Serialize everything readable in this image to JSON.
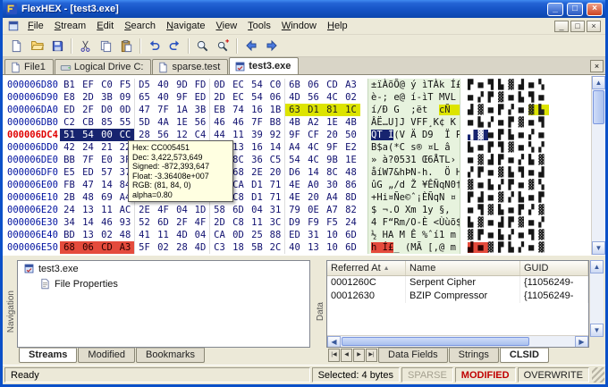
{
  "titlebar": {
    "title": "FlexHEX - [test3.exe]"
  },
  "menu": {
    "items": [
      "File",
      "Stream",
      "Edit",
      "Search",
      "Navigate",
      "View",
      "Tools",
      "Window",
      "Help"
    ]
  },
  "toolbar": {
    "groups": [
      [
        "new-file-icon",
        "open-folder-icon",
        "save-icon"
      ],
      [
        "cut-icon",
        "copy-icon",
        "paste-icon"
      ],
      [
        "undo-icon",
        "redo-icon"
      ],
      [
        "find-icon",
        "find-next-icon"
      ],
      [
        "back-icon",
        "forward-icon"
      ]
    ]
  },
  "doc_tabs": [
    {
      "label": "File1",
      "icon": "file-icon",
      "active": false
    },
    {
      "label": "Logical Drive C:",
      "icon": "drive-icon",
      "active": false
    },
    {
      "label": "sparse.test",
      "icon": "file-icon",
      "active": false
    },
    {
      "label": "test3.exe",
      "icon": "exe-icon",
      "active": true
    }
  ],
  "hex": {
    "rows": [
      {
        "addr": "000006D80",
        "bytes": [
          "B1",
          "EF",
          "C0",
          "F5",
          "D5",
          "40",
          "9D",
          "FD",
          "0D",
          "EC",
          "54",
          "C0",
          "6B",
          "06",
          "CD",
          "A3"
        ],
        "ansi": "±ïÀõÕ@ ý ìTÀk Í£",
        "uni": "▛■▜▙▓▟■▚"
      },
      {
        "addr": "000006D90",
        "bytes": [
          "E8",
          "2D",
          "3B",
          "09",
          "65",
          "40",
          "9F",
          "ED",
          "2D",
          "EC",
          "54",
          "06",
          "4D",
          "56",
          "4C",
          "02"
        ],
        "ansi": "è-; e@ í-ìT MVL ",
        "uni": "■▞▛▓■▙▜■"
      },
      {
        "addr": "000006DA0",
        "bytes": [
          "ED",
          "2F",
          "D0",
          "0D",
          "47",
          "7F",
          "1A",
          "3B",
          "EB",
          "74",
          "16",
          "1B",
          "63",
          "D1",
          "81",
          "1C"
        ],
        "ansi": "í/Ð G  ;ët  cÑ  ",
        "uni": "▟▓■▛▞■▓▙",
        "hl": [
          12,
          15
        ]
      },
      {
        "addr": "000006DB0",
        "bytes": [
          "C2",
          "CB",
          "85",
          "55",
          "5D",
          "4A",
          "1E",
          "56",
          "46",
          "46",
          "7F",
          "B8",
          "4B",
          "A2",
          "1E",
          "4B"
        ],
        "ansi": "ÂË…U]J VFF¸K¢ K ",
        "uni": "■▙▞■▛▓■▜"
      },
      {
        "addr": "000006DC4",
        "bytes": [
          "51",
          "54",
          "00",
          "CC",
          "28",
          "56",
          "12",
          "C4",
          "44",
          "11",
          "39",
          "92",
          "9F",
          "CF",
          "20",
          "50"
        ],
        "ansi": "QT Ì(V Ä D9  Ï P",
        "uni": "▜▓■▛▙■▞■",
        "sel": [
          0,
          3
        ],
        "addr_sel": true
      },
      {
        "addr": "000006DD0",
        "bytes": [
          "42",
          "24",
          "21",
          "22",
          "2A",
          "43",
          "03",
          "73",
          "8C",
          "13",
          "16",
          "14",
          "A4",
          "4C",
          "9F",
          "E2"
        ],
        "ansi": "B$a(*C s® ¤L â  ",
        "uni": "▙■▛▜▓■▚▞"
      },
      {
        "addr": "000006DE0",
        "bytes": [
          "BB",
          "7F",
          "E0",
          "3F",
          "30",
          "35",
          "33",
          "31",
          "1D",
          "8C",
          "36",
          "C5",
          "54",
          "4C",
          "9B",
          "1E"
        ],
        "ansi": "» à?0531 Œ6ÅTL› ",
        "uni": "■▓▟▛■▞▙▓"
      },
      {
        "addr": "000006DF0",
        "bytes": [
          "E5",
          "ED",
          "57",
          "37",
          "26",
          "68",
          "DE",
          "4E",
          "2D",
          "68",
          "2E",
          "20",
          "D6",
          "14",
          "8C",
          "48"
        ],
        "ansi": "åíW7&hÞN-h.  Ö H",
        "uni": "▞▛■▓▙▜■▟"
      },
      {
        "addr": "000006E00",
        "bytes": [
          "FB",
          "47",
          "14",
          "84",
          "5C",
          "64",
          "8E",
          "19",
          "A5",
          "CA",
          "D1",
          "71",
          "4E",
          "A0",
          "30",
          "86"
        ],
        "ansi": "ûG „/d Ž ¥ÊÑqN0†",
        "uni": "▓■▙▞▛■▓▚"
      },
      {
        "addr": "000006E10",
        "bytes": [
          "2B",
          "48",
          "69",
          "A4",
          "D1",
          "65",
          "A9",
          "88",
          "A1",
          "C8",
          "D1",
          "71",
          "4E",
          "20",
          "A4",
          "8D"
        ],
        "ansi": "+Hi¤Ñe©ˆ¡ÈÑqN ¤ ",
        "uni": "▛▟■▓▞▙■▛"
      },
      {
        "addr": "000006E20",
        "bytes": [
          "24",
          "13",
          "11",
          "AC",
          "2E",
          "4F",
          "04",
          "1D",
          "58",
          "6D",
          "04",
          "31",
          "79",
          "0E",
          "A7",
          "82"
        ],
        "ansi": "$ ¬.O Xm 1y §‚  ",
        "uni": "■▜▓▙■▛▞▓"
      },
      {
        "addr": "000006E30",
        "bytes": [
          "34",
          "14",
          "46",
          "93",
          "52",
          "6D",
          "2F",
          "4F",
          "2D",
          "C8",
          "11",
          "3C",
          "D9",
          "F9",
          "F5",
          "24"
        ],
        "ansi": "4 F“Rm/O-È <Ùùõ$",
        "uni": "▙▓■▟▛▓■▞"
      },
      {
        "addr": "000006E40",
        "bytes": [
          "BD",
          "13",
          "02",
          "48",
          "41",
          "11",
          "4D",
          "04",
          "CA",
          "0D",
          "25",
          "88",
          "ED",
          "31",
          "10",
          "6D"
        ],
        "ansi": "½ HA M Ê %ˆí1 m ",
        "uni": "▓▛■▙▞■▜▓"
      },
      {
        "addr": "000006E50",
        "bytes": [
          "68",
          "06",
          "CD",
          "A3",
          "5F",
          "02",
          "28",
          "4D",
          "C3",
          "18",
          "5B",
          "2C",
          "40",
          "13",
          "10",
          "6D"
        ],
        "ansi": "h Í£_ (MÃ [,@ m ",
        "uni": "▟■▓▛▙▞■▓",
        "red": [
          0,
          3
        ]
      }
    ],
    "tooltip": {
      "lines": [
        "Hex: CC005451",
        "Dec: 3,422,573,649",
        "Signed: -872,393,647",
        "Float: -3.36408e+007",
        "RGB: (81, 84, 0) alpha=0.80"
      ]
    }
  },
  "navigation": {
    "panel_label": "Navigation",
    "tree": [
      {
        "label": "test3.exe",
        "icon": "exe-icon",
        "level": 0
      },
      {
        "label": "File Properties",
        "icon": "properties-icon",
        "level": 1
      }
    ],
    "tabs": [
      "Streams",
      "Modified",
      "Bookmarks"
    ],
    "active_tab": "Streams"
  },
  "data_panel": {
    "panel_label": "Data",
    "columns": [
      "Referred At",
      "Name",
      "GUID"
    ],
    "sort_column": "Referred At",
    "rows": [
      [
        "0001260C",
        "Serpent Cipher",
        "{11056249-"
      ],
      [
        "00012630",
        "BZIP Compressor",
        "{11056249-"
      ]
    ],
    "tabs": [
      "Data Fields",
      "Strings",
      "CLSID"
    ],
    "active_tab": "CLSID"
  },
  "status": {
    "ready": "Ready",
    "selection": "Selected: 4 bytes",
    "flags": [
      {
        "label": "SPARSE",
        "state": "disabled"
      },
      {
        "label": "MODIFIED",
        "state": "active"
      },
      {
        "label": "OVERWRITE",
        "state": "normal"
      }
    ]
  },
  "colors": {
    "titlebar_blue": "#1553c5",
    "selection_bg": "#17246f",
    "highlight_yellow": "#dde400",
    "modified_red": "#e44b3c",
    "ansi_column_bg": "#e7f3de",
    "tooltip_bg": "#ffffe1"
  }
}
